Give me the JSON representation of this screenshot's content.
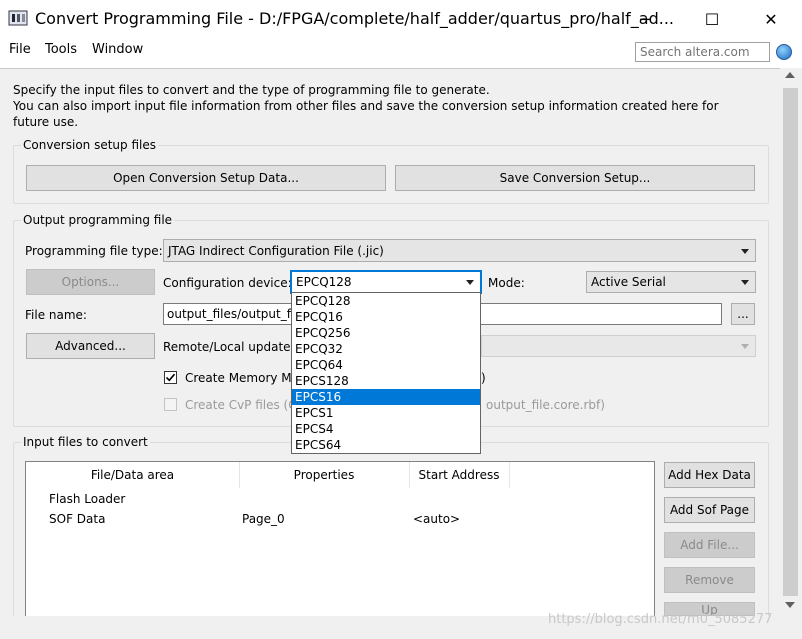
{
  "window": {
    "title": "Convert Programming File - D:/FPGA/complete/half_adder/quartus_pro/half_ad...",
    "minimize": "─",
    "maximize": "☐",
    "close": "✕"
  },
  "menu": {
    "file": "File",
    "tools": "Tools",
    "window": "Window",
    "search_placeholder": "Search altera.com"
  },
  "intro": {
    "line1": "Specify the input files to convert and the type of programming file to generate.",
    "line2": "You can also import input file information from other files and save the conversion setup information created here for",
    "line3": "future use."
  },
  "setup": {
    "group_label": "Conversion setup files",
    "open_button": "Open Conversion Setup Data...",
    "save_button": "Save Conversion Setup..."
  },
  "output": {
    "group_label": "Output programming file",
    "type_label": "Programming file type:",
    "type_value": "JTAG Indirect Configuration File (.jic)",
    "options_button": "Options...",
    "device_label": "Configuration device:",
    "device_value": "EPCQ128",
    "mode_label": "Mode:",
    "mode_value": "Active Serial",
    "file_name_label": "File name:",
    "file_name_value": "output_files/output_fil",
    "browse_button": "...",
    "advanced_button": "Advanced...",
    "remote_label": "Remote/Local update d",
    "create_map_label": "Create Memory Ma",
    "create_map_suffix": ")",
    "create_map_checked": true,
    "create_cvp_label": "Create CvP files (G",
    "create_cvp_suffix": "output_file.core.rbf)"
  },
  "device_options": [
    "EPCQ128",
    "EPCQ16",
    "EPCQ256",
    "EPCQ32",
    "EPCQ64",
    "EPCS128",
    "EPCS16",
    "EPCS1",
    "EPCS4",
    "EPCS64"
  ],
  "device_selected_index": 6,
  "input": {
    "group_label": "Input files to convert",
    "columns": [
      "File/Data area",
      "Properties",
      "Start Address"
    ],
    "rows": [
      {
        "area": "Flash Loader",
        "properties": "",
        "start": ""
      },
      {
        "area": "SOF Data",
        "properties": "Page_0",
        "start": "<auto>"
      }
    ],
    "add_hex_button": "Add Hex Data",
    "add_sof_button": "Add Sof Page",
    "add_file_button": "Add File...",
    "remove_button": "Remove",
    "up_button": "Up"
  },
  "watermark": "https://blog.csdn.net/m0_5085277"
}
